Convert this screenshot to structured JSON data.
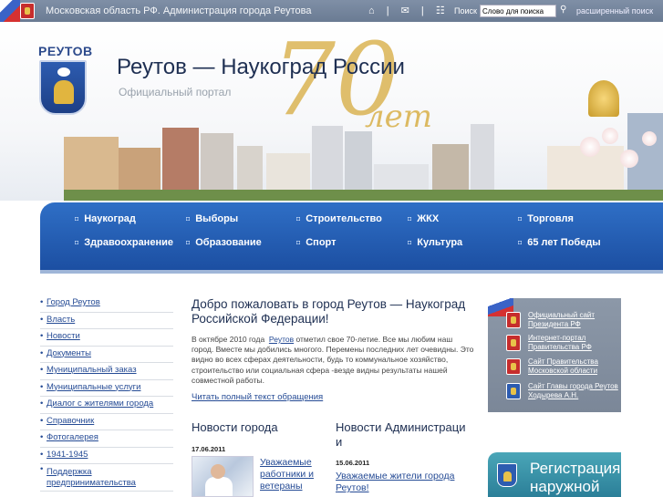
{
  "topbar": {
    "title": "Московская область РФ. Администрация города Реутова",
    "icons": [
      "home-icon",
      "mail-icon",
      "sitemap-icon"
    ],
    "search_label": "Поиск",
    "search_value": "Слово для поиска",
    "advanced": "расширенный поиск"
  },
  "header": {
    "logo": "РЕУТОВ",
    "title": "Реутов — Наукоград России",
    "subtitle": "Официальный портал",
    "anniv_number": "70",
    "anniv_word": "лет"
  },
  "nav": [
    {
      "label": "Наукоград"
    },
    {
      "label": "Выборы"
    },
    {
      "label": "Строительство"
    },
    {
      "label": "ЖКХ"
    },
    {
      "label": "Торговля"
    },
    {
      "label": "Здравоохранение"
    },
    {
      "label": "Образование"
    },
    {
      "label": "Спорт"
    },
    {
      "label": "Культура"
    },
    {
      "label": "65 лет Победы"
    }
  ],
  "sidebar": [
    "Город Реутов",
    "Власть",
    "Новости",
    "Документы",
    "Муниципальный заказ",
    "Муниципальные услуги",
    "Диалог с жителями города",
    "Справочник",
    "Фотогалерея",
    "1941-1945",
    "Поддержка предпринимательства"
  ],
  "welcome": {
    "title": "Добро пожаловать в город Реутов — Наукоград Российской Федерации!",
    "body_pre": "В октябре 2010 года",
    "body_link": "Реутов",
    "body_post": "отметил свое 70-летие. Все мы любим наш город. Вместе мы добились многого. Перемены последних лет очевидны. Это видно во всех сферах деятельности, будь то коммунальное хозяйство, строительство или социальная сфера  -везде видны результаты нашей совместной работы.",
    "read_more": "Читать полный текст обращения"
  },
  "news_city": {
    "title": "Новости города",
    "date": "17.06.2011",
    "link": "Уважаемые работники и ветераны"
  },
  "news_admin": {
    "title": "Новости Администраци и",
    "date": "15.06.2011",
    "link": "Уважаемые жители города Реутов!"
  },
  "right_links": [
    {
      "text": "Официальный сайт Президента РФ",
      "icon": "russia-emblem-icon"
    },
    {
      "text": "Интернет-портал Правительства РФ",
      "icon": "russia-emblem-icon"
    },
    {
      "text": "Сайт Правительства Московской области",
      "icon": "moscow-region-emblem-icon"
    },
    {
      "text": "Сайт Главы города Реутов Ходырева А.Н.",
      "icon": "reutov-emblem-icon"
    }
  ],
  "register_banner": {
    "line1": "Регистрация",
    "line2": "наружной"
  },
  "colors": {
    "nav_bg": "#2f6fc6",
    "link": "#254b95",
    "topbar": "#7f8fa6",
    "anniv_gold": "#d6aa3c"
  }
}
